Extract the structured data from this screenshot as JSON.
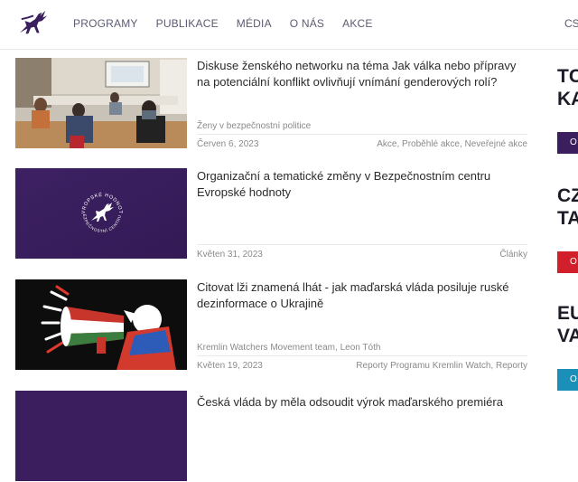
{
  "nav": {
    "items": [
      "PROGRAMY",
      "PUBLIKACE",
      "MÉDIA",
      "O NÁS",
      "AKCE"
    ],
    "lang": "CS"
  },
  "articles": [
    {
      "title": "Diskuse ženského networku na téma Jak válka nebo přípravy na potenciální konflikt ovlivňují vnímání genderových rolí?",
      "authors": "Ženy v bezpečnostní politice",
      "date": "Červen 6, 2023",
      "tags": "Akce, Proběhlé akce, Neveřejné akce"
    },
    {
      "title": "Organizační a tematické změny v Bezpečnostním centru Evropské hodnoty",
      "authors": "",
      "date": "Květen 31, 2023",
      "tags": "Články",
      "logo_text_top": "EVROPSKÉ HODNOTY",
      "logo_text_bottom": "BEZPEČNOSTNÍ CENTRUM"
    },
    {
      "title": "Citovat lži znamená lhát - jak maďarská vláda posiluje ruské dezinformace o Ukrajině",
      "authors": "Kremlin Watchers Movement team, Leon Tóth",
      "date": "Květen 19, 2023",
      "tags": "Reporty Programu Kremlin Watch, Reporty"
    },
    {
      "title": "Česká vláda by měla odsoudit výrok maďarského premiéra",
      "authors": "",
      "date": "",
      "tags": ""
    }
  ],
  "sidebar": {
    "teasers": [
      {
        "line1": "TC",
        "line2": "KA",
        "button": "O",
        "color": "#3b1e5e"
      },
      {
        "line1": "CZ",
        "line2": "TA",
        "button": "O",
        "color": "#d11f2b"
      },
      {
        "line1": "EU",
        "line2": "VA",
        "button": "O",
        "color": "#1a8fb8"
      }
    ]
  },
  "colors": {
    "brand_purple": "#3b1e5e",
    "red": "#d11f2b",
    "teal": "#1a8fb8"
  }
}
